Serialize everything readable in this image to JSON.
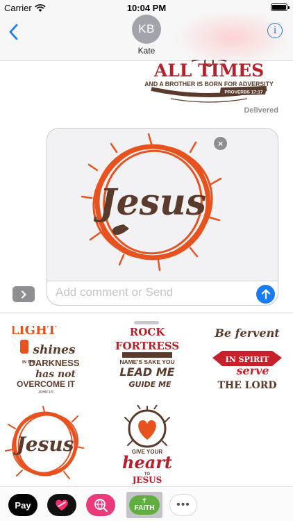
{
  "status_bar": {
    "carrier": "Carrier",
    "time": "10:04 PM"
  },
  "header": {
    "avatar_initials": "KB",
    "contact_name": "Kate",
    "info_label": "i"
  },
  "conversation": {
    "sent_sticker": {
      "line1": "ALL TIMES",
      "line2": "AND A BROTHER IS BORN FOR ADVERSITY",
      "reference": "PROVERBS 17:17"
    },
    "delivered": "Delivered"
  },
  "compose": {
    "placeholder": "Add comment or Send",
    "attachment_text": "Jesus"
  },
  "stickers": {
    "light": {
      "word1": "LIGHT",
      "word2": "shines",
      "word3": "IN THE",
      "word4": "DARKNESS",
      "word5": "has not",
      "word6": "OVERCOME IT",
      "ref": "JOHN 1:5"
    },
    "rock": {
      "line1": "ROCK",
      "line2": "FORTRESS",
      "line3": "NAME'S SAKE YOU",
      "line4": "LEAD ME",
      "line5": "GUIDE ME"
    },
    "fervent": {
      "line1": "Be fervent",
      "line2": "IN SPIRIT",
      "line3": "serve",
      "line4": "THE LORD"
    },
    "jesus": {
      "text": "Jesus"
    },
    "heart": {
      "line1": "GIVE YOUR",
      "line2": "heart",
      "line3": "TO",
      "line4": "JESUS"
    }
  },
  "app_strip": {
    "apple_pay": " Pay",
    "faith_cross": "✝",
    "faith_label": "FAITH",
    "more": "•••"
  },
  "colors": {
    "accent_blue": "#1a7cf5",
    "crown_orange": "#e8521e",
    "brown": "#5a3a2a",
    "crimson": "#b5202a"
  }
}
